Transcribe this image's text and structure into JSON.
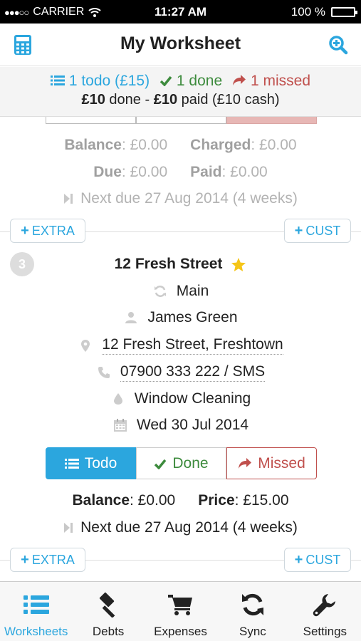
{
  "status_bar": {
    "carrier": "CARRIER",
    "time": "11:27 AM",
    "battery": "100 %"
  },
  "header": {
    "title": "My Worksheet"
  },
  "summary": {
    "todo": "1 todo (£15)",
    "done": "1 done",
    "missed": "1 missed",
    "totals": {
      "done_amount": "£10",
      "done_label": "done -",
      "paid_amount": "£10",
      "paid_label": "paid (£10 cash)"
    }
  },
  "prev_job": {
    "balance_label": "Balance",
    "balance_value": ": £0.00",
    "charged_label": "Charged",
    "charged_value": ": £0.00",
    "due_label": "Due",
    "due_value": ": £0.00",
    "paid_label": "Paid",
    "paid_value": ": £0.00",
    "next_due": "Next due 27 Aug 2014 (4 weeks)"
  },
  "actions": {
    "extra": "EXTRA",
    "cust": "CUST"
  },
  "job": {
    "number": "3",
    "address_title": "12 Fresh Street",
    "round": "Main",
    "customer": "James Green",
    "address": "12 Fresh Street, Freshtown",
    "phone": "07900 333 222",
    "sms": "SMS",
    "service": "Window Cleaning",
    "date": "Wed 30 Jul 2014",
    "buttons": {
      "todo": "Todo",
      "done": "Done",
      "missed": "Missed"
    },
    "balance_label": "Balance",
    "balance_value": ": £0.00",
    "price_label": "Price",
    "price_value": ": £15.00",
    "next_due": "Next due 27 Aug 2014 (4 weeks)"
  },
  "tabs": [
    {
      "label": "Worksheets",
      "icon": "list-icon"
    },
    {
      "label": "Debts",
      "icon": "gavel-icon"
    },
    {
      "label": "Expenses",
      "icon": "cart-icon"
    },
    {
      "label": "Sync",
      "icon": "refresh-icon"
    },
    {
      "label": "Settings",
      "icon": "wrench-icon"
    }
  ],
  "colors": {
    "accent": "#2ba6de",
    "done": "#3d8b3d",
    "missed": "#c0504d",
    "star": "#f5c518"
  }
}
